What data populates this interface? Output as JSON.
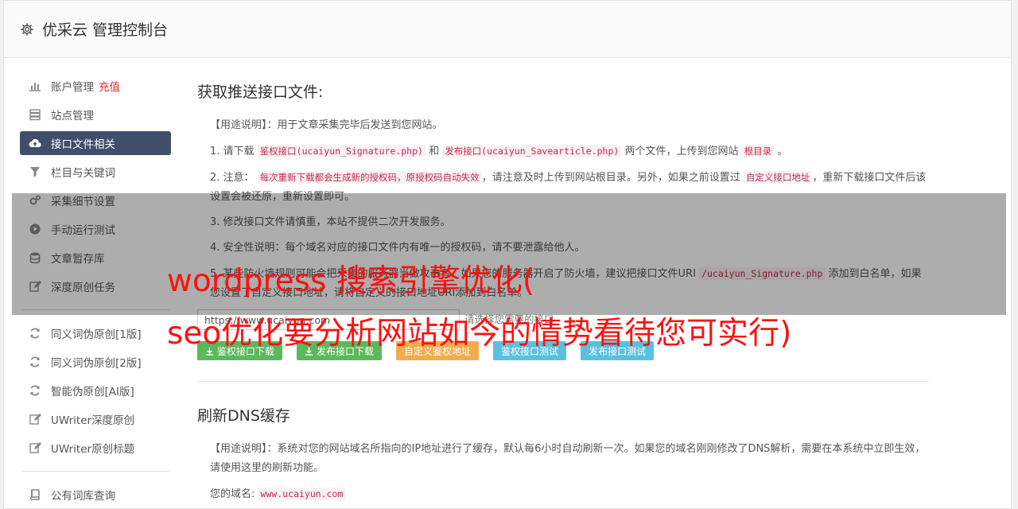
{
  "header": {
    "title": "优采云 管理控制台"
  },
  "sidebar": {
    "group1": [
      {
        "label": "账户管理",
        "extra": "充值",
        "icon": "bar-chart-icon"
      },
      {
        "label": "站点管理",
        "icon": "server-icon"
      },
      {
        "label": "接口文件相关",
        "icon": "cloud-upload-icon",
        "active": true
      },
      {
        "label": "栏目与关键词",
        "icon": "filter-icon"
      },
      {
        "label": "采集细节设置",
        "icon": "gears-icon"
      },
      {
        "label": "手动运行测试",
        "icon": "play-icon"
      },
      {
        "label": "文章暂存库",
        "icon": "database-icon"
      },
      {
        "label": "深度原创任务",
        "icon": "edit-icon"
      }
    ],
    "group2": [
      {
        "label": "同义词伪原创[1版]",
        "icon": "refresh-icon"
      },
      {
        "label": "同义词伪原创[2版]",
        "icon": "refresh-icon"
      },
      {
        "label": "智能伪原创[AI版]",
        "icon": "refresh-icon"
      },
      {
        "label": "UWriter深度原创",
        "icon": "edit-icon"
      },
      {
        "label": "UWriter原创标题",
        "icon": "edit-icon"
      }
    ],
    "group3": [
      {
        "label": "公有词库查询",
        "icon": "book-icon"
      }
    ]
  },
  "section1": {
    "title": "获取推送接口文件:",
    "usage": "【用途说明】：用于文章采集完毕后发送到您网站。",
    "item1": {
      "a": "1. 请下载",
      "code1": "鉴权接口(ucaiyun_Signature.php)",
      "b": "和",
      "code2": "发布接口(ucaiyun_Savearticle.php)",
      "c": "两个文件，上传到您网站",
      "code3": "根目录",
      "d": "。"
    },
    "item2": {
      "a": "2. 注意：",
      "code1": "每次重新下载都会生成新的授权码，原授权码自动失效",
      "b": "，请注意及时上传到网站根目录。另外，如果之前设置过",
      "code2": "自定义接口地址",
      "c": "，重新下载接口文件后该设置会被还原，重新设置即可。"
    },
    "item3": "3. 修改接口文件请慎重，本站不提供二次开发服务。",
    "item4": "4. 安全性说明：每个域名对应的接口文件内有唯一的授权码，请不要泄露给他人。",
    "item5": {
      "a": "5. 某些防火墙规则可能会把采集的服务器当做攻击者，如果您的服务器开启了防火墙，建议把接口文件URI",
      "code1": "/ucaiyun_Signature.php",
      "b": "添加到白名单，如果您设置了自定义接口地址，请将自定义的接口地址URI添加到白名单。"
    },
    "input_value": "https://www.ucaiyun.com",
    "input_hint": "请选择您需要的接口",
    "buttons": {
      "b1": "鉴权接口下载",
      "b2": "发布接口下载",
      "b3": "自定义鉴权地址",
      "b4": "鉴权接口测试",
      "b5": "发布接口测试"
    }
  },
  "section2": {
    "title": "刷新DNS缓存",
    "usage": "【用途说明】：系统对您的网站域名所指向的IP地址进行了缓存，默认每6小时自动刷新一次。如果您的域名刚刚修改了DNS解析，需要在本系统中立即生效，请使用这里的刷新功能。",
    "domain_label": "您的域名:",
    "domain_value": "www.ucaiyun.com"
  },
  "watermark": {
    "line1": "wordpress 搜索引擎优化(",
    "line2": "seo优化要分析网站如今的情势看待您可实行)"
  },
  "colors": {
    "nav_active": "#3f4e6b",
    "recharge": "#e12626",
    "btn_green": "#5cb85c",
    "btn_orange": "#f0ad4e",
    "btn_blue": "#5bc0de",
    "watermark": "#ff1010"
  }
}
